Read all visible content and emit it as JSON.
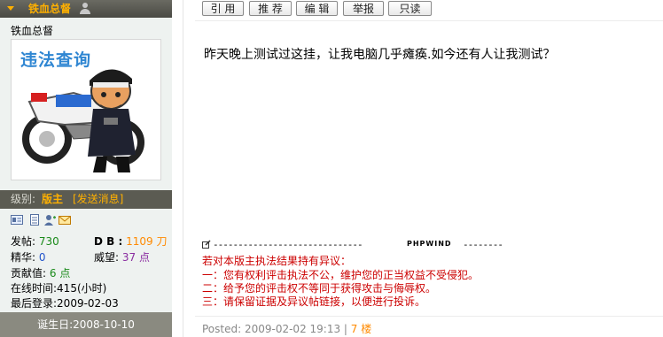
{
  "user": {
    "username": "铁血总督",
    "title": "铁血总督",
    "avatar_text": "违法查询",
    "level_label": "级别:",
    "level_value": "版主",
    "send_message": "[发送消息]",
    "stats": {
      "posts_label": "发帖:",
      "posts": "730",
      "db_label": "D B :",
      "db": "1109 刀",
      "essence_label": "精华:",
      "essence": "0",
      "prestige_label": "威望:",
      "prestige": "37 点",
      "contribution_label": "贡献值:",
      "contribution": "6 点",
      "online_label": "在线时间:",
      "online": "415(小时)",
      "last_login_label": "最后登录:",
      "last_login": "2009-02-03"
    },
    "birthday": "诞生日:2008-10-10"
  },
  "actions": [
    "引 用",
    "推 荐",
    "编 辑",
    "举报",
    "只读"
  ],
  "post": {
    "content": "昨天晚上测试过这挂，让我电脑几乎瘫痪.如今还有人让我测试？",
    "signature": {
      "dashes_left": "------------------------------",
      "brand": "PHPWIND",
      "dashes_right": "--------",
      "lines": [
        "若对本版主执法结果持有异议：",
        "一：您有权利评击执法不公，维护您的正当权益不受侵犯。",
        "二：给予您的评击权不等同于获得攻击与侮辱权。",
        "三：请保留证据及异议帖链接，以便进行投诉。"
      ]
    },
    "posted_text": "Posted: 2009-02-02 19:13",
    "separator": " | ",
    "floor": "7 楼"
  },
  "colors": {
    "accent": "#ffb000",
    "warning_red": "#cc0000",
    "banner_blue": "#2f86d2"
  }
}
